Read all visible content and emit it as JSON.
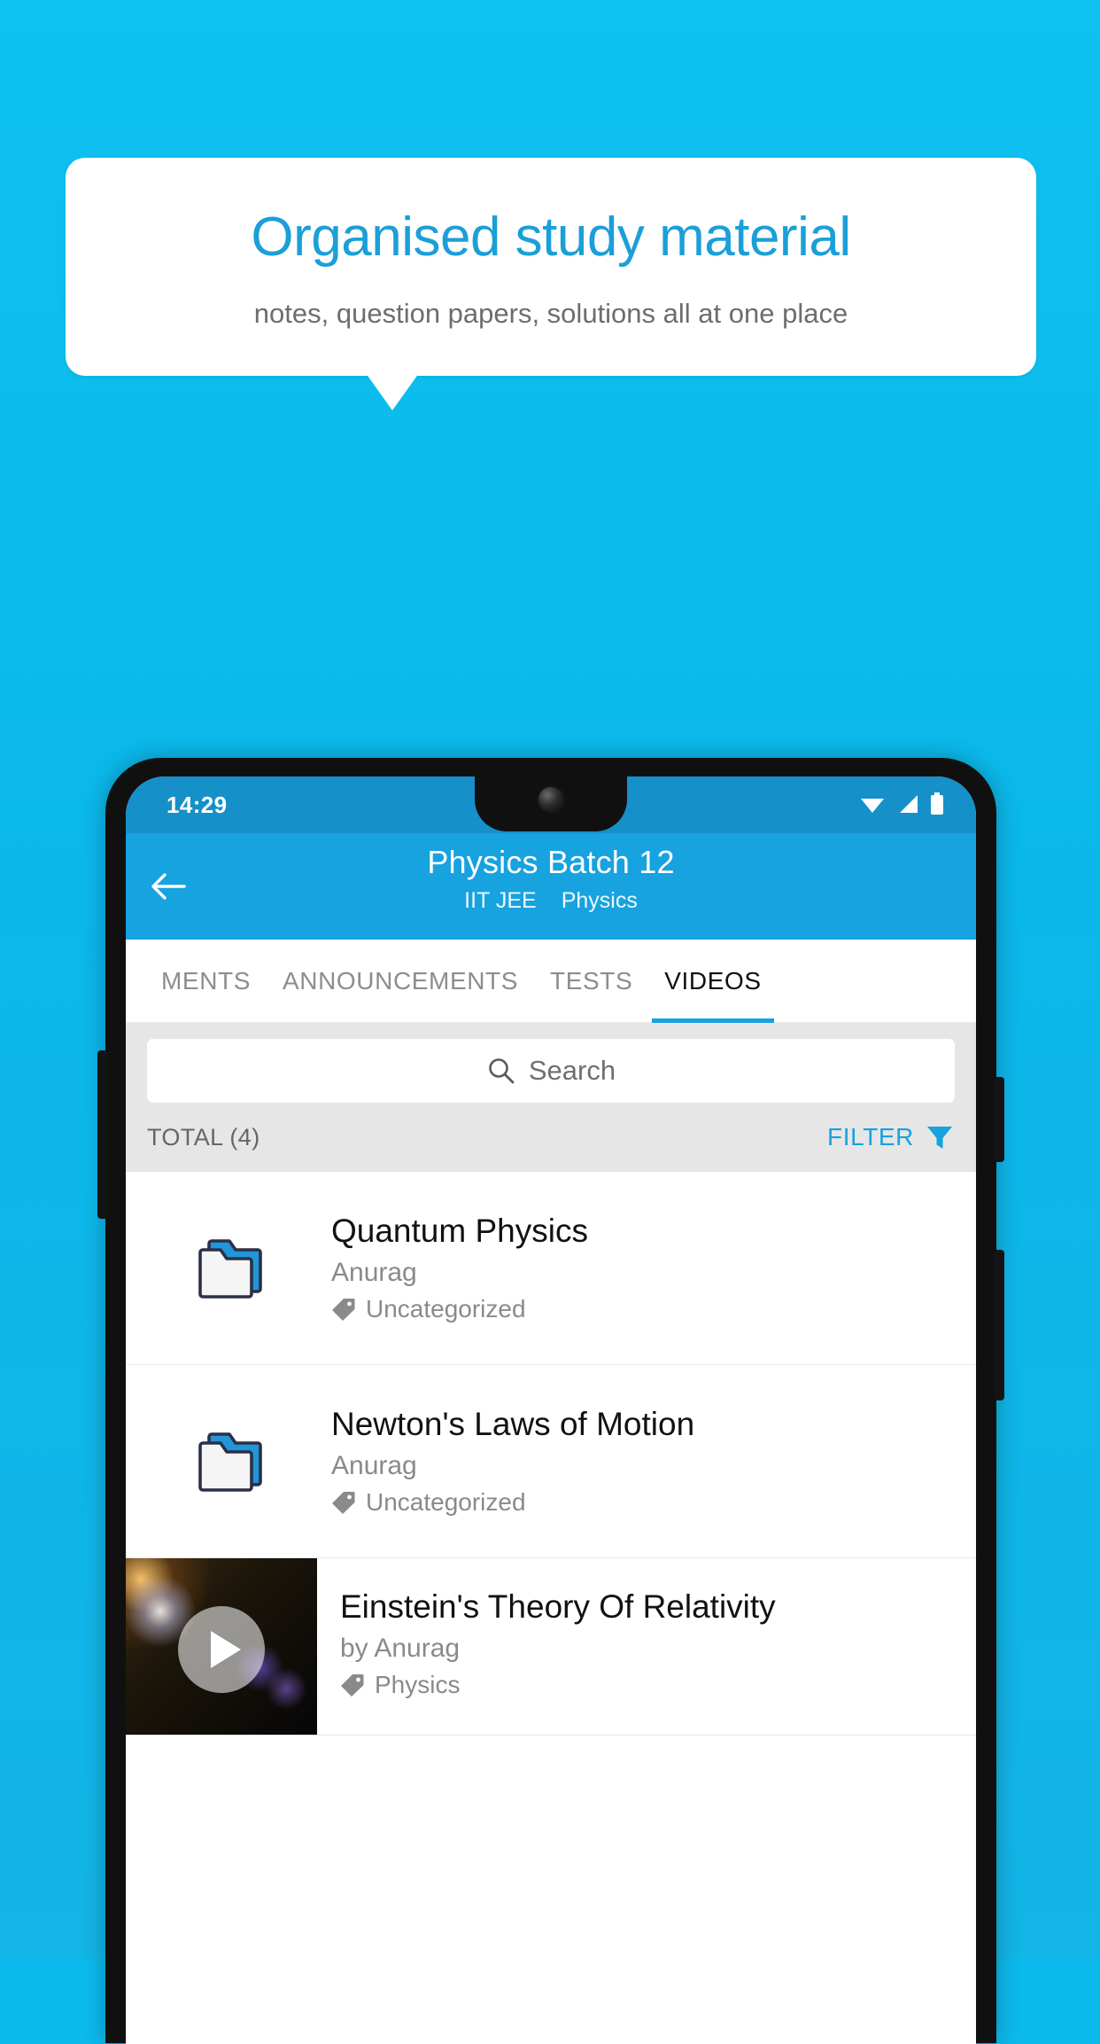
{
  "promo": {
    "title": "Organised study material",
    "subtitle": "notes, question papers, solutions all at one place",
    "accent_color": "#1b9fd8",
    "background_color": "#0cb9ec"
  },
  "phone": {
    "statusbar": {
      "clock": "14:29",
      "icons": [
        "wifi-icon",
        "signal-icon",
        "battery-icon"
      ]
    },
    "appbar": {
      "back_icon": "back-arrow-icon",
      "title": "Physics Batch 12",
      "subtitle_exam": "IIT JEE",
      "subtitle_subject": "Physics",
      "color": "#17a2e0"
    },
    "tabs": [
      {
        "label": "MENTS",
        "active": false
      },
      {
        "label": "ANNOUNCEMENTS",
        "active": false
      },
      {
        "label": "TESTS",
        "active": false
      },
      {
        "label": "VIDEOS",
        "active": true
      }
    ],
    "search": {
      "placeholder": "Search",
      "icon": "search-icon"
    },
    "toolbar": {
      "total_label": "TOTAL (4)",
      "filter_label": "FILTER",
      "filter_icon": "filter-funnel-icon",
      "filter_color": "#17a2e0"
    },
    "list": [
      {
        "type": "folder",
        "icon": "folder-icon",
        "title": "Quantum Physics",
        "author": "Anurag",
        "tag": "Uncategorized",
        "tag_icon": "tag-icon"
      },
      {
        "type": "folder",
        "icon": "folder-icon",
        "title": "Newton's Laws of Motion",
        "author": "Anurag",
        "tag": "Uncategorized",
        "tag_icon": "tag-icon"
      },
      {
        "type": "video",
        "icon": "play-icon",
        "title": "Einstein's Theory Of Relativity",
        "author": "by Anurag",
        "tag": "Physics",
        "tag_icon": "tag-icon"
      }
    ]
  }
}
